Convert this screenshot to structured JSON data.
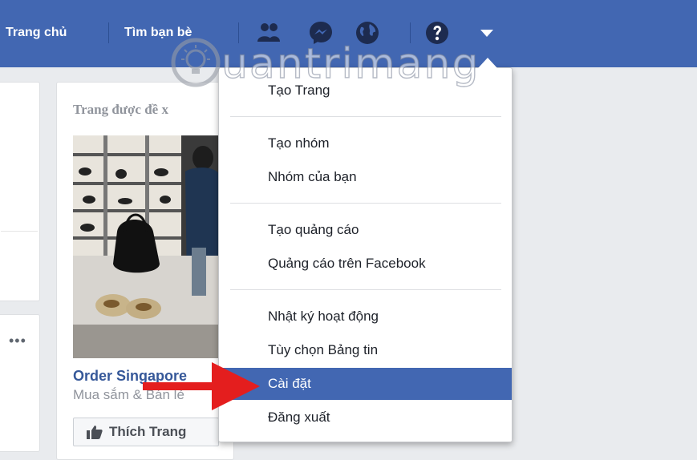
{
  "topbar": {
    "nav": [
      "Trang chủ",
      "Tìm bạn bè"
    ],
    "icons": [
      "friends-icon",
      "messenger-icon",
      "globe-icon",
      "help-icon",
      "caret-down-icon"
    ],
    "color": "#4267b2"
  },
  "watermark": {
    "text": "uantrimang"
  },
  "left": {
    "more": "•••"
  },
  "suggest": {
    "title": "Trang được đề x",
    "page_name": "Order Singapore",
    "page_category": "Mua sắm & Bán lẻ",
    "like_label": "Thích Trang"
  },
  "menu": {
    "groups": [
      [
        "Tạo Trang"
      ],
      [
        "Tạo nhóm",
        "Nhóm của bạn"
      ],
      [
        "Tạo quảng cáo",
        "Quảng cáo trên Facebook"
      ],
      [
        "Nhật ký hoạt động",
        "Tùy chọn Bảng tin",
        "Cài đặt",
        "Đăng xuất"
      ]
    ],
    "items": {
      "create_page": "Tạo Trang",
      "create_group": "Tạo nhóm",
      "your_groups": "Nhóm của bạn",
      "create_ad": "Tạo quảng cáo",
      "ads_on_facebook": "Quảng cáo trên Facebook",
      "activity_log": "Nhật ký hoạt động",
      "news_feed_prefs": "Tùy chọn Bảng tin",
      "settings": "Cài đặt",
      "log_out": "Đăng xuất"
    },
    "highlighted": "Cài đặt",
    "highlight_color": "#4267b2"
  },
  "annotation": {
    "arrow_color": "#e41e1e"
  }
}
